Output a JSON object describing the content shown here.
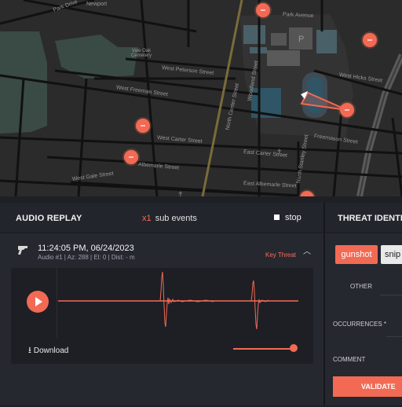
{
  "map": {
    "streets": [
      "Park Drive",
      "Park Avenue",
      "Vale Oak Cemetery",
      "West Peterson Street",
      "West Freeman Street",
      "Woodland Street",
      "North Center Street",
      "West Carter Street",
      "Freemason Street",
      "West Hicks Street",
      "East Carter Street",
      "North Stanley Street",
      "West Gale Street",
      "East Albemarle Street",
      "Albemarle Street",
      "Newport"
    ],
    "marker_color": "#f26a54"
  },
  "replay": {
    "title": "AUDIO REPLAY",
    "sub_count": "x1",
    "sub_label": "sub events",
    "stop_label": "stop"
  },
  "event": {
    "time": "11:24:05 PM, 06/24/2023",
    "meta": "Audio #1 | Az: 288 | El: 0 | Dist: - m",
    "badge": "Key Threat",
    "download_label": "Download",
    "volume": 0.97
  },
  "threat": {
    "title": "THREAT IDENTIF",
    "chip_selected": "gunshot",
    "chip_other": "snip",
    "other_label": "OTHER",
    "occurrences_label": "OCCURRENCES *",
    "comment_label": "COMMENT",
    "validate_label": "VALIDATE"
  },
  "colors": {
    "accent": "#f26a54",
    "background": "#1e2026",
    "panel": "#262830"
  }
}
